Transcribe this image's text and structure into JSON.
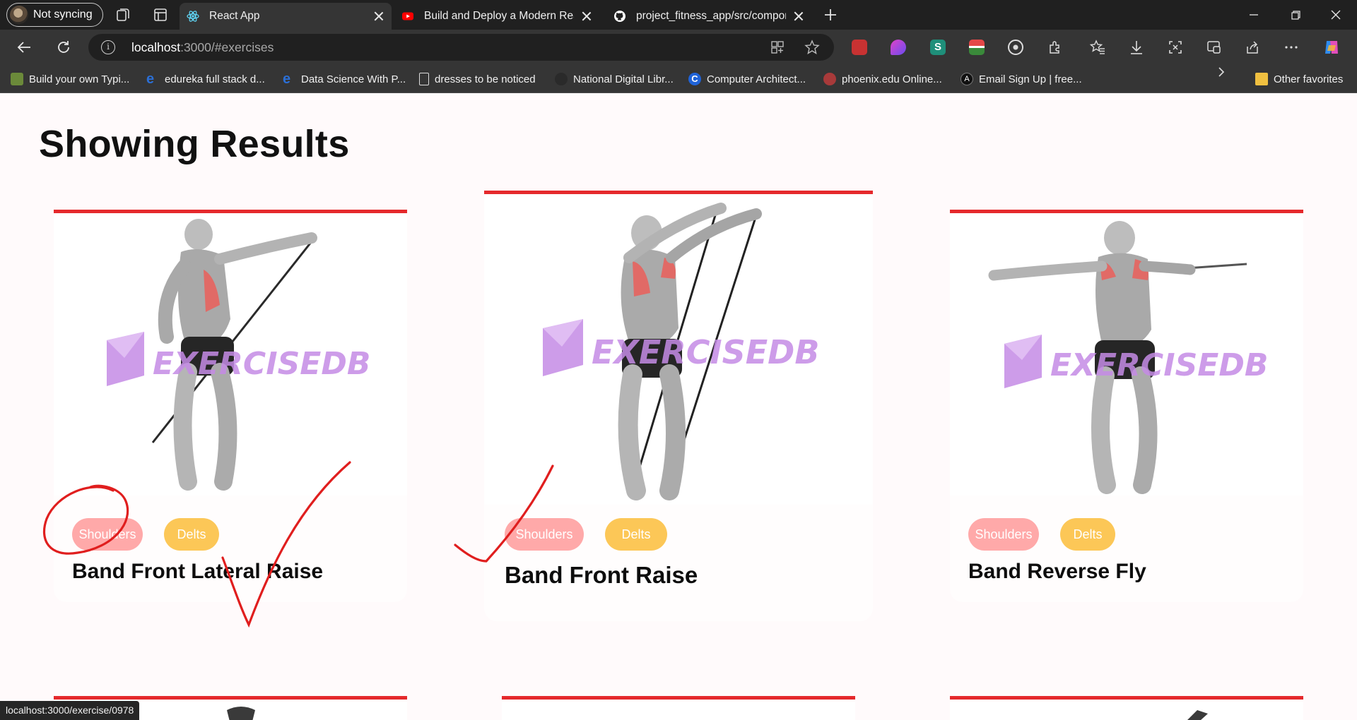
{
  "browser": {
    "profile_label": "Not syncing",
    "tabs": [
      {
        "title": "React App",
        "icon": "react-icon",
        "active": true
      },
      {
        "title": "Build and Deploy a Modern React",
        "icon": "youtube-icon",
        "active": false
      },
      {
        "title": "project_fitness_app/src/componen",
        "icon": "github-icon",
        "active": false
      }
    ],
    "address": {
      "host": "localhost",
      "rest": ":3000/#exercises"
    },
    "bookmarks": [
      {
        "label": "Build your own Typi...",
        "icon": "bookmark-favicon"
      },
      {
        "label": "edureka full stack d...",
        "icon": "edureka-icon"
      },
      {
        "label": "Data Science With P...",
        "icon": "edureka-icon"
      },
      {
        "label": "dresses to be noticed",
        "icon": "page-icon"
      },
      {
        "label": "National Digital Libr...",
        "icon": "ndl-icon"
      },
      {
        "label": "Computer Architect...",
        "icon": "c-icon"
      },
      {
        "label": "phoenix.edu Online...",
        "icon": "phoenix-icon"
      },
      {
        "label": "Email Sign Up | free...",
        "icon": "a-icon"
      }
    ],
    "other_favorites": "Other favorites",
    "status_url": "localhost:3000/exercise/0978"
  },
  "page": {
    "heading": "Showing Results",
    "watermark": "EXERCISEDB",
    "exercises": [
      {
        "name": "Band Front Lateral Raise",
        "body_part": "Shoulders",
        "target": "Delts"
      },
      {
        "name": "Band Front Raise",
        "body_part": "Shoulders",
        "target": "Delts"
      },
      {
        "name": "Band Reverse Fly",
        "body_part": "Shoulders",
        "target": "Delts"
      }
    ]
  },
  "colors": {
    "card_border": "#e5292c",
    "body_part_pill": "#ffa9a9",
    "target_pill": "#fcc757",
    "watermark": "#c58be6",
    "annotation": "#e01e1e"
  }
}
